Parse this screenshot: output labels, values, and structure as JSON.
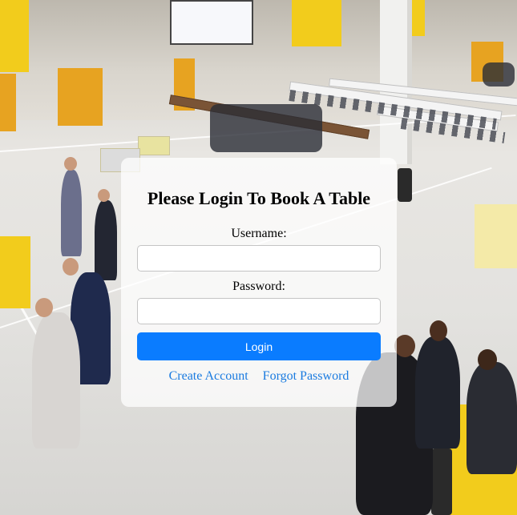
{
  "login": {
    "title": "Please Login To Book A Table",
    "username_label": "Username:",
    "username_value": "",
    "password_label": "Password:",
    "password_value": "",
    "login_button": "Login",
    "create_account_link": "Create Account",
    "forgot_password_link": "Forgot Password"
  },
  "colors": {
    "primary_button": "#0a7cff",
    "link": "#1a7be0",
    "card_background": "rgba(255,255,255,0.74)",
    "accent_yellow": "#f2cc1c"
  },
  "background": {
    "description_icon": "school-canteen-photo"
  }
}
